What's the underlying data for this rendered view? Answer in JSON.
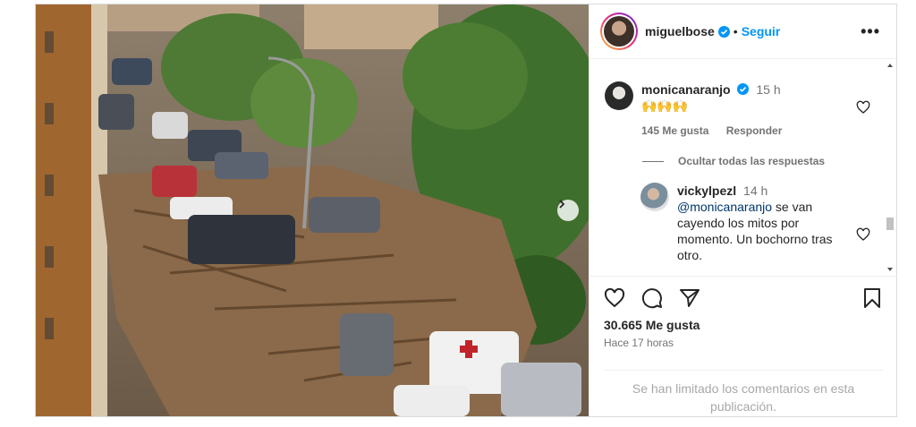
{
  "header": {
    "username": "miguelbose",
    "separator": "•",
    "follow_label": "Seguir",
    "more_icon": "•••"
  },
  "comments": [
    {
      "username": "monicanaranjo",
      "verified": true,
      "time": "15 h",
      "text": "🙌🙌🙌",
      "likes": "145 Me gusta",
      "reply_label": "Responder"
    }
  ],
  "hide_replies_label": "Ocultar todas las respuestas",
  "reply": {
    "username": "vickylpezl",
    "time": "14 h",
    "mention": "@monicanaranjo",
    "text": " se van cayendo los mitos por momento. Un bochorno tras otro."
  },
  "footer": {
    "likes": "30.665 Me gusta",
    "time": "Hace 17 horas",
    "comments_limited": "Se han limitado los comentarios en esta publicación."
  },
  "icons": {
    "like": "heart-icon",
    "comment": "comment-icon",
    "share": "share-icon",
    "save": "bookmark-icon",
    "next": "chevron-right-icon"
  },
  "colors": {
    "accent": "#0095f6",
    "verified": "#0095f6",
    "muted": "#737373",
    "disabled": "#a8a8a8"
  }
}
